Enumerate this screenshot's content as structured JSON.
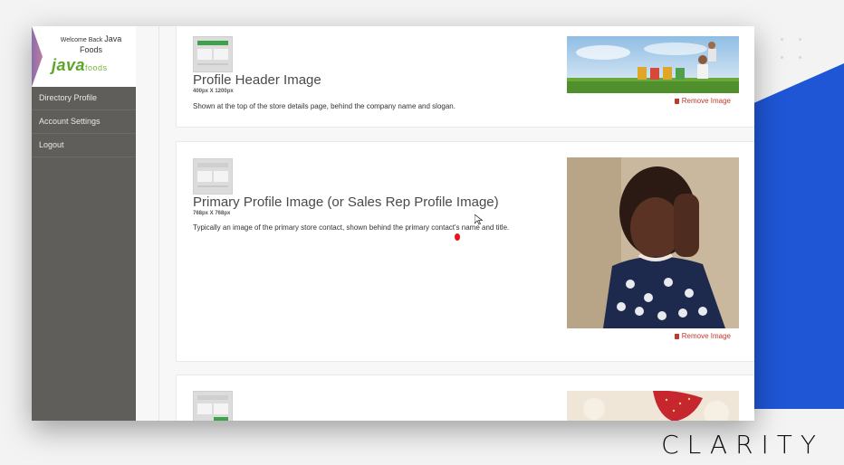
{
  "sidebar": {
    "welcome_text": "Welcome Back",
    "username": "Java Foods",
    "logo_main": "java",
    "logo_sub": "foods",
    "items": [
      {
        "label": "Directory Profile"
      },
      {
        "label": "Account Settings"
      },
      {
        "label": "Logout"
      }
    ]
  },
  "cards": [
    {
      "title": "Profile Header Image",
      "size": "400px X 1200px",
      "description": "Shown at the top of the store details page, behind the company name and slogan.",
      "remove_label": "Remove Image"
    },
    {
      "title": "Primary Profile Image (or Sales Rep Profile Image)",
      "size": "768px X 768px",
      "description": "Typically an image of the primary store contact, shown behind the primary contact's name and title.",
      "remove_label": "Remove Image"
    }
  ],
  "brand_mark": "CLARITY",
  "colors": {
    "accent_blue": "#1e56d6",
    "sidebar": "#5f5e5a",
    "logo_green": "#5aa52a",
    "remove_red": "#c0392b"
  }
}
